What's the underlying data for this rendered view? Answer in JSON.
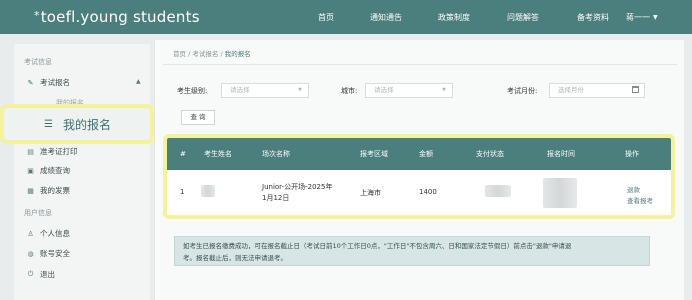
{
  "header": {
    "logo": "toefl.young students",
    "logo_mark": "*",
    "nav": [
      "首页",
      "通知通告",
      "政策制度",
      "问题解答",
      "备考资料"
    ],
    "user": "蒋一一"
  },
  "sidebar": {
    "group1": "考试信息",
    "exam_signup": "考试报名",
    "sub_faded": "我的报名",
    "highlight_item": "我的报名",
    "items_mid": [
      "准考证打印",
      "成绩查询",
      "我的发票"
    ],
    "group2": "用户信息",
    "items_user": [
      "个人信息",
      "账号安全",
      "退出"
    ]
  },
  "breadcrumb": {
    "home": "首页",
    "sep": "/",
    "parent": "考试报名",
    "current": "我的报名"
  },
  "filters": {
    "level_label": "考生级别:",
    "level_placeholder": "请选择",
    "city_label": "城市:",
    "city_placeholder": "请选择",
    "month_label": "考试月份:",
    "month_placeholder": "选择月份",
    "query_button": "查 询"
  },
  "table": {
    "headers": [
      "#",
      "考生姓名",
      "场次名称",
      "报考区域",
      "金额",
      "支付状态",
      "报名时间",
      "操作"
    ],
    "rows": [
      {
        "index": "1",
        "session_line1": "Junior-公开场-2025年",
        "session_line2": "1月12日",
        "region": "上海市",
        "amount": "1400",
        "action_refund": "退款",
        "action_view": "查看报考"
      }
    ]
  },
  "notice": {
    "line1": "如考生已报名缴费成功，可在报名截止日（考试日前10个工作日0点，\"工作日\"不包含周六、日和国家法定节假日）前点击\"退款\"申请退",
    "line2": "考。报名截止后，则无法申请退考。"
  },
  "colors": {
    "primary": "#4a7f7d",
    "highlight": "#f2f39a"
  }
}
